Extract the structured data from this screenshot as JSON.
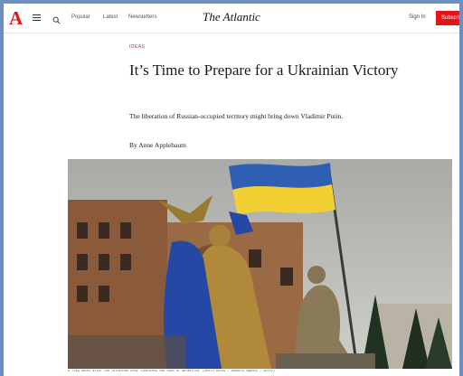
{
  "header": {
    "logo": "A",
    "nav": [
      "Popular",
      "Latest",
      "Newsletters"
    ],
    "brand": "The Atlantic",
    "sign_in": "Sign In",
    "subscribe": "Subscribe"
  },
  "icons": {
    "menu": "hamburger-icon",
    "search": "search-icon"
  },
  "article": {
    "section": "Ideas",
    "headline": "It’s Time to Prepare for a Ukrainian Victory",
    "dek": "The liberation of Russian-occupied territory might bring down Vladimir Putin.",
    "byline": "By Anne Applebaum",
    "photo_caption": "A flag waves after the Ukrainian army liberated the town of Balakliia. (Metin Aktas / Anadolu Agency / Getty)"
  },
  "colors": {
    "brand_red": "#e7131a",
    "page_bg": "#ffffff",
    "desktop_bg": "#6b8fc0"
  }
}
